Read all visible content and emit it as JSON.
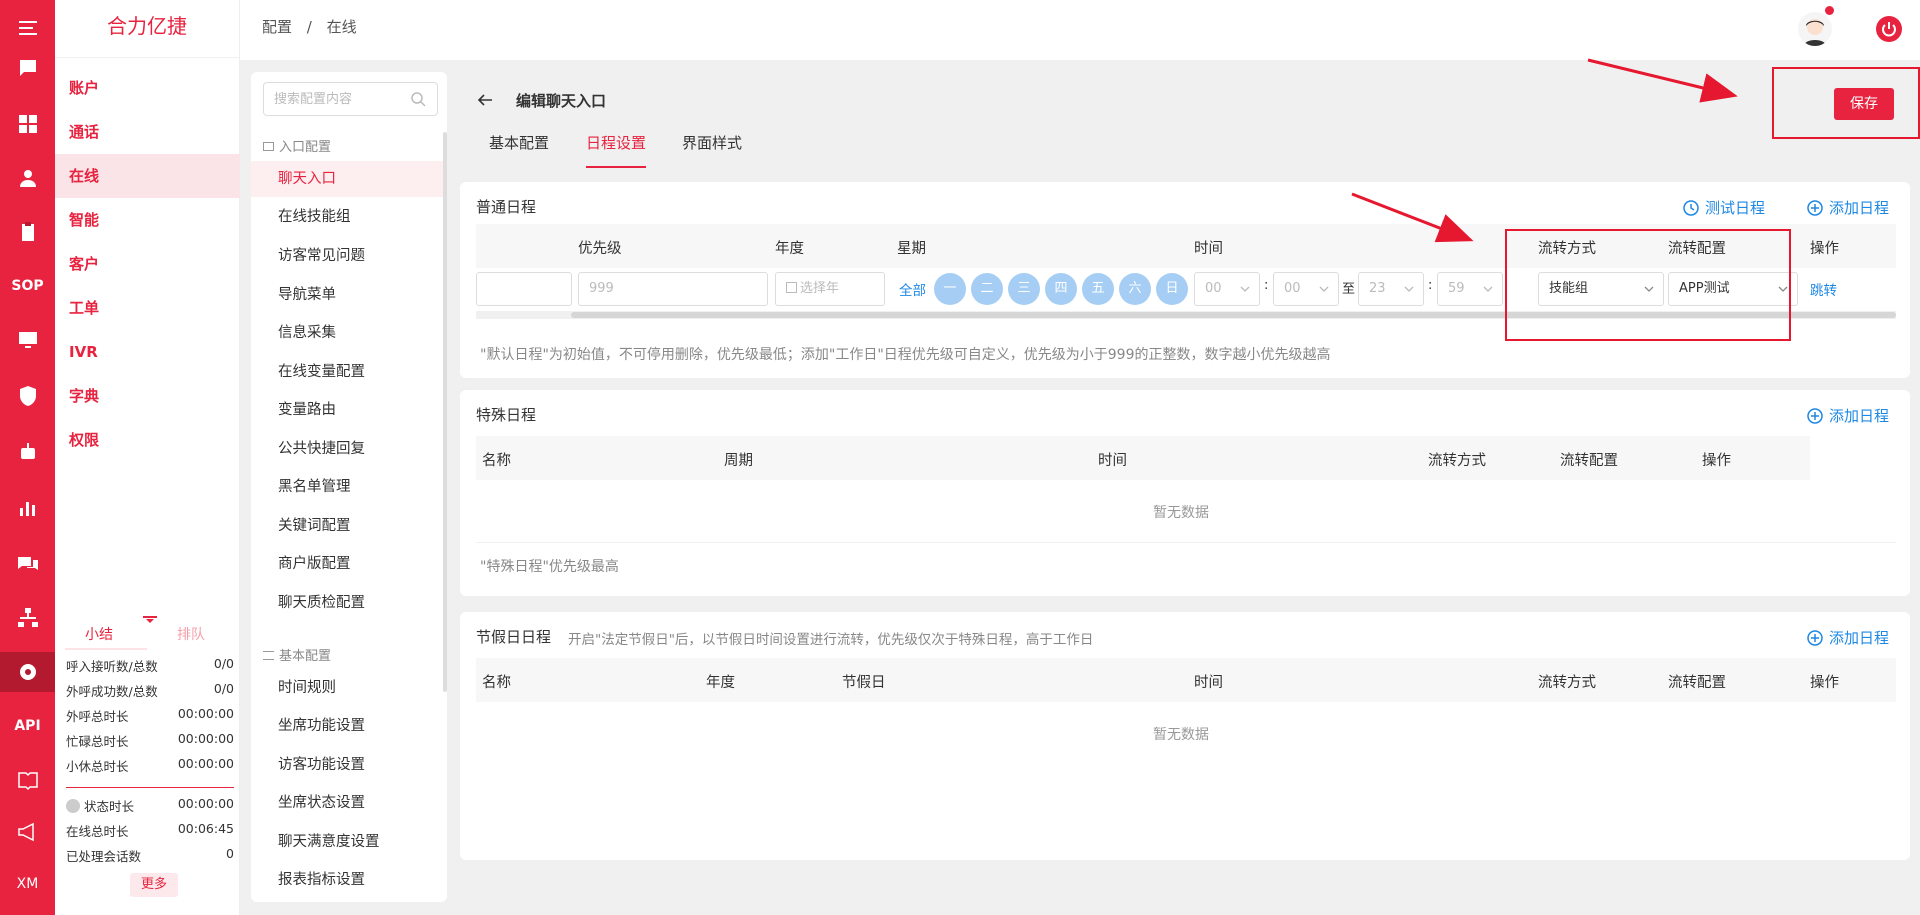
{
  "app": {
    "brand": "合力亿捷"
  },
  "rail": {
    "sop_label": "SOP",
    "api_label": "API",
    "xm_label": "XM"
  },
  "sidebar": {
    "items": [
      {
        "label": "账户"
      },
      {
        "label": "通话"
      },
      {
        "label": "在线"
      },
      {
        "label": "智能"
      },
      {
        "label": "客户"
      },
      {
        "label": "工单"
      },
      {
        "label": "IVR"
      },
      {
        "label": "字典"
      },
      {
        "label": "权限"
      }
    ],
    "summary_tab": "小结",
    "queue_tab": "排队",
    "stats": [
      {
        "label": "呼入接听数/总数",
        "value": "0/0"
      },
      {
        "label": "外呼成功数/总数",
        "value": "0/0"
      },
      {
        "label": "外呼总时长",
        "value": "00:00:00"
      },
      {
        "label": "忙碌总时长",
        "value": "00:00:00"
      },
      {
        "label": "小休总时长",
        "value": "00:00:00"
      }
    ],
    "stats2": [
      {
        "label": "状态时长",
        "value": "00:00:00"
      },
      {
        "label": "在线总时长",
        "value": "00:06:45"
      },
      {
        "label": "已处理会话数",
        "value": "0"
      }
    ],
    "more_label": "更多"
  },
  "topbar": {
    "breadcrumb_root": "配置",
    "breadcrumb_sep": "/",
    "breadcrumb_current": "在线"
  },
  "config_menu": {
    "search_placeholder": "搜索配置内容",
    "group1": "入口配置",
    "group1_items": [
      "聊天入口",
      "在线技能组",
      "访客常见问题",
      "导航菜单",
      "信息采集",
      "在线变量配置",
      "变量路由",
      "公共快捷回复",
      "黑名单管理",
      "关键词配置",
      "商户版配置",
      "聊天质检配置"
    ],
    "group2": "基本配置",
    "group2_items": [
      "时间规则",
      "坐席功能设置",
      "访客功能设置",
      "坐席状态设置",
      "聊天满意度设置",
      "报表指标设置"
    ]
  },
  "page": {
    "title": "编辑聊天入口",
    "save_label": "保存",
    "tabs": [
      "基本配置",
      "日程设置",
      "界面样式"
    ],
    "active_tab": "日程设置"
  },
  "normal_schedule": {
    "title": "普通日程",
    "test_label": "测试日程",
    "add_label": "添加日程",
    "headers": [
      "优先级",
      "年度",
      "星期",
      "时间",
      "流转方式",
      "流转配置",
      "操作"
    ],
    "row": {
      "priority_placeholder": "999",
      "year_placeholder": "选择年",
      "all_label": "全部",
      "days": [
        "一",
        "二",
        "三",
        "四",
        "五",
        "六",
        "日"
      ],
      "start_hour": "00",
      "start_min": "00",
      "to_label": "至",
      "end_hour": "23",
      "end_min": "59",
      "transfer_mode": "技能组",
      "transfer_config": "APP测试",
      "action": "跳转"
    },
    "note": "\"默认日程\"为初始值，不可停用删除，优先级最低；添加\"工作日\"日程优先级可自定义，优先级为小于999的正整数，数字越小优先级越高"
  },
  "special_schedule": {
    "title": "特殊日程",
    "add_label": "添加日程",
    "headers": [
      "名称",
      "周期",
      "时间",
      "流转方式",
      "流转配置",
      "操作"
    ],
    "empty": "暂无数据",
    "note": "\"特殊日程\"优先级最高"
  },
  "holiday_schedule": {
    "title": "节假日日程",
    "hint": "开启\"法定节假日\"后，以节假日时间设置进行流转，优先级仅次于特殊日程，高于工作日",
    "add_label": "添加日程",
    "headers": [
      "名称",
      "年度",
      "节假日",
      "时间",
      "流转方式",
      "流转配置",
      "操作"
    ],
    "empty": "暂无数据"
  },
  "colors": {
    "brand": "#e8233f",
    "link": "#1e88e5",
    "day_chip": "#a6cef5"
  }
}
